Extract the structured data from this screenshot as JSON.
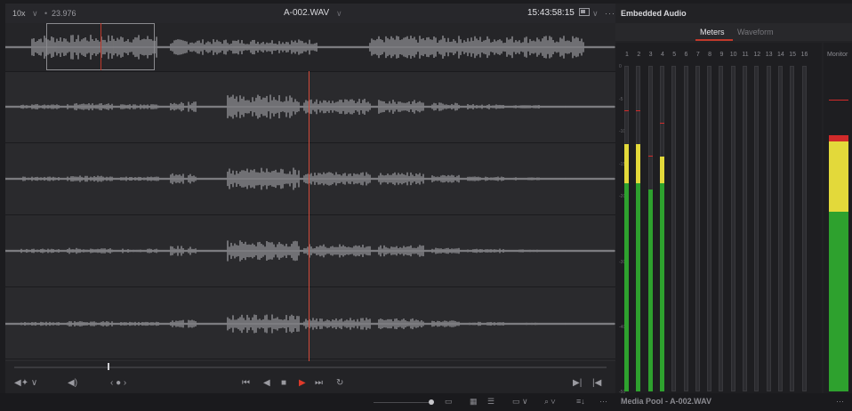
{
  "topbar": {
    "zoom": "10x",
    "framerate": "23.976",
    "clip_name": "A-002.WAV",
    "timecode": "15:43:58:15",
    "more": "···"
  },
  "right_panel": {
    "title": "Embedded Audio",
    "tabs": [
      "Meters",
      "Waveform"
    ],
    "active_tab": "Meters",
    "channels": [
      "1",
      "2",
      "3",
      "4",
      "5",
      "6",
      "7",
      "8",
      "9",
      "10",
      "11",
      "12",
      "13",
      "14",
      "15",
      "16"
    ],
    "scale": [
      "0",
      "-5",
      "-10",
      "-15",
      "-20",
      "-30",
      "-40",
      "-50"
    ],
    "monitor_label": "Monitor",
    "levels": [
      {
        "channel": "1",
        "peak_db": -12
      },
      {
        "channel": "2",
        "peak_db": -12
      },
      {
        "channel": "3",
        "peak_db": -19
      },
      {
        "channel": "4",
        "peak_db": -14
      }
    ]
  },
  "transport": {
    "audio_dropdown": "◀✦ ∨",
    "volume": "◀)",
    "nav": "‹ ● ›",
    "controls": [
      "⏮",
      "◀",
      "■",
      "▶",
      "⏭",
      "↻"
    ],
    "mark_in": "▶|",
    "mark_out": "|◀"
  },
  "bottom": {
    "media_pool_title": "Media Pool - A-002.WAV",
    "more": "···"
  },
  "colors": {
    "accent": "#c0392b",
    "meter_green": "#2ea12e",
    "meter_yellow": "#e3d93a",
    "meter_red": "#d12a2a",
    "waveform": "#8f8f93"
  }
}
